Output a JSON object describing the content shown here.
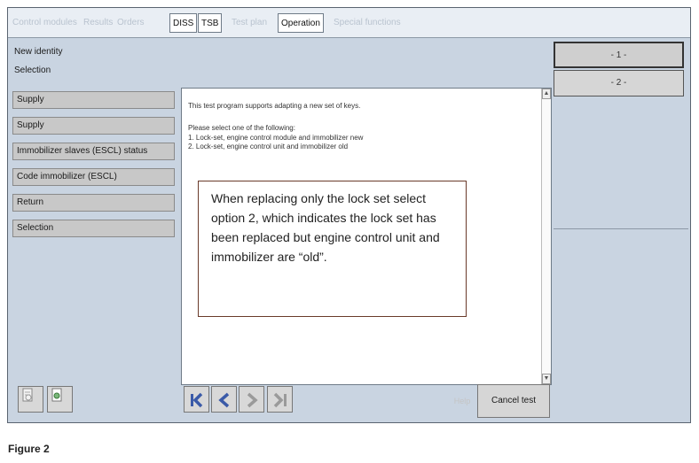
{
  "tabs": [
    {
      "label": "Control modules",
      "active": false
    },
    {
      "label": "Results",
      "active": false
    },
    {
      "label": "Orders",
      "active": false
    },
    {
      "label": "DISS",
      "active": true
    },
    {
      "label": "TSB",
      "active": true
    },
    {
      "label": "Test plan",
      "active": false
    },
    {
      "label": "Operation",
      "active": true
    },
    {
      "label": "Special functions",
      "active": false
    }
  ],
  "identity": {
    "line1": "New identity",
    "line2": "Selection"
  },
  "steps": [
    "- 1 -",
    "- 2 -"
  ],
  "menu": [
    "Supply",
    "Supply",
    "Immobilizer slaves (ESCL) status",
    "Code immobilizer (ESCL)",
    "Return",
    "Selection"
  ],
  "content": {
    "intro": "This test program supports adapting a new set of keys.",
    "prompt": "Please select one of the following:",
    "option1": "1. Lock-set, engine control module and immobilizer new",
    "option2": "2. Lock-set, engine control unit and immobilizer old"
  },
  "callout": "When replacing only the lock set select option 2, which indicates the lock set has been replaced but engine control unit and immobilizer are “old”.",
  "buttons": {
    "help": "Help",
    "cancel": "Cancel test"
  },
  "colors": {
    "accent": "#3a5aa8",
    "panel": "#c9d4e1"
  },
  "caption": "Figure 2"
}
